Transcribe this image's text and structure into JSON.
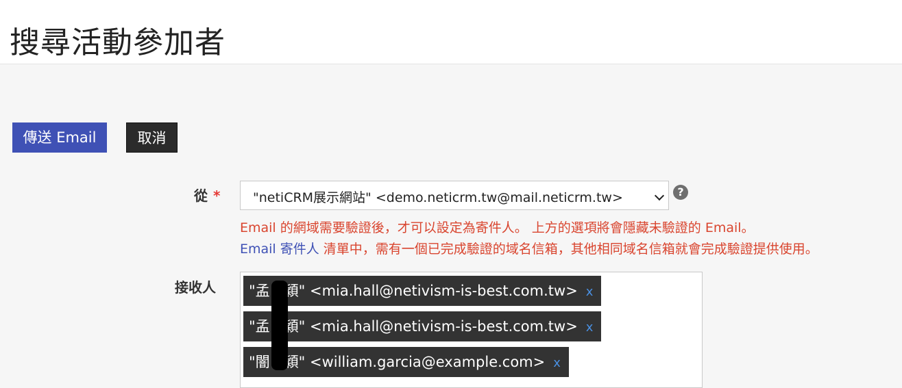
{
  "header": {
    "title": "搜尋活動參加者"
  },
  "actions": {
    "send_label": "傳送 Email",
    "cancel_label": "取消"
  },
  "from": {
    "label": "從",
    "required_mark": "*",
    "selected": "\"netiCRM展示網站\" <demo.neticrm.tw@mail.neticrm.tw>",
    "help_icon": "?"
  },
  "notices": {
    "line1": "Email 的網域需要驗證後，才可以設定為寄件人。 上方的選項將會隱藏未驗證的 Email。",
    "line2_link": "Email 寄件人",
    "line2_rest": " 清單中，需有一個已完成驗證的域名信箱，其他相同域名信箱就會完成驗證提供使用。"
  },
  "recipients": {
    "label": "接收人",
    "remove_label": "x",
    "items": [
      {
        "text": "\"孟　穎\" <mia.hall@netivism-is-best.com.tw>"
      },
      {
        "text": "\"孟　穎\" <mia.hall@netivism-is-best.com.tw>"
      },
      {
        "text": "\"闇　穎\" <william.garcia@example.com>"
      }
    ]
  }
}
